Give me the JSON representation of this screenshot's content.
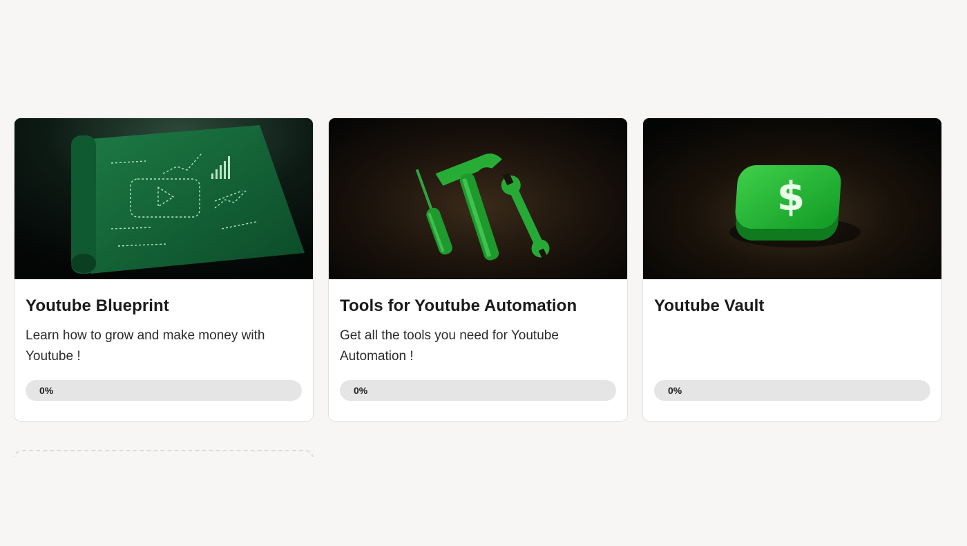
{
  "courses": [
    {
      "title": "Youtube Blueprint",
      "description": "Learn how to grow and make money with Youtube !",
      "progress_percent": 0,
      "progress_label": "0%",
      "image_icon": "blueprint-icon"
    },
    {
      "title": "Tools for Youtube Automation",
      "description": "Get all the tools you need for Youtube Automation !",
      "progress_percent": 0,
      "progress_label": "0%",
      "image_icon": "tools-icon"
    },
    {
      "title": "Youtube Vault",
      "description": "",
      "progress_percent": 0,
      "progress_label": "0%",
      "image_icon": "dollar-vault-icon"
    }
  ],
  "colors": {
    "page_background": "#f7f6f4",
    "accent_green": "#1fa532",
    "progress_track": "#e5e5e5"
  }
}
